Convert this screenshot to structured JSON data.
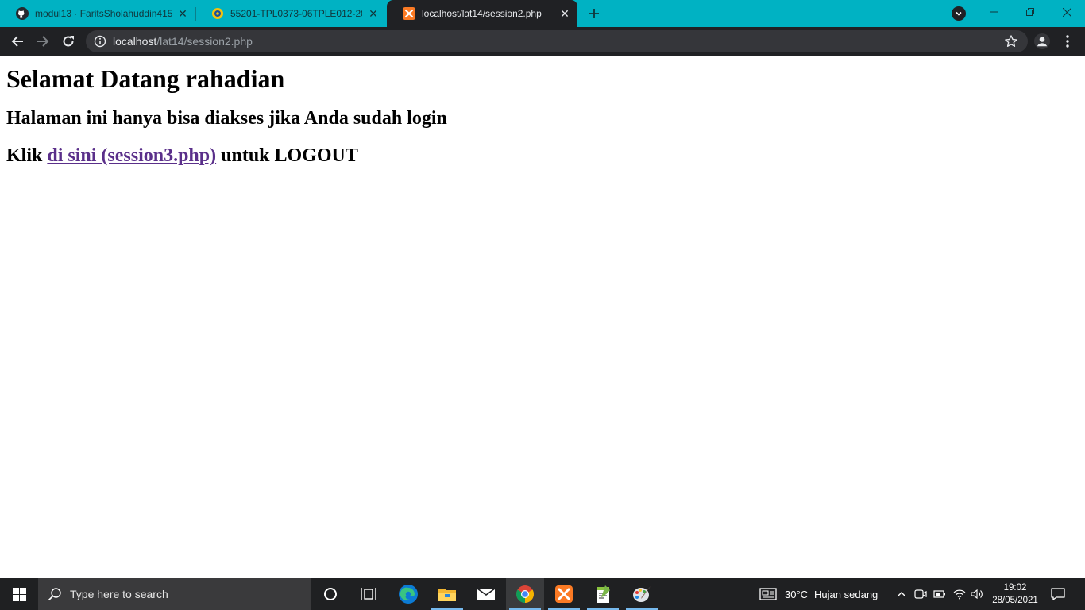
{
  "browser": {
    "tabs": [
      {
        "title": "modul13 · FaritsSholahuddin415/",
        "icon": "github-icon",
        "active": false
      },
      {
        "title": "55201-TPL0373-06TPLE012-2020",
        "icon": "university-logo-icon",
        "active": false
      },
      {
        "title": "localhost/lat14/session2.php",
        "icon": "xampp-icon",
        "active": true
      }
    ],
    "address": {
      "host": "localhost",
      "path": "/lat14/session2.php"
    }
  },
  "page": {
    "heading": "Selamat Datang rahadian",
    "subheading": "Halaman ini hanya bisa diakses jika Anda sudah login",
    "logout_prefix": "Klik",
    "logout_link": "di sini (session3.php)",
    "logout_suffix": "untuk LOGOUT"
  },
  "taskbar": {
    "search_placeholder": "Type here to search",
    "apps": [
      "cortana-icon",
      "task-view-icon",
      "edge-icon",
      "file-explorer-icon",
      "mail-icon",
      "chrome-icon",
      "xampp-icon",
      "notepad-plus-plus-icon",
      "paint-icon"
    ],
    "weather_temp": "30°C",
    "weather_desc": "Hujan sedang",
    "time": "19:02",
    "date": "28/05/2021"
  },
  "colors": {
    "tabstrip": "#00b2c3",
    "toolbar": "#202124",
    "link_visited": "#5a2f8a",
    "taskbar": "#1f2022"
  }
}
